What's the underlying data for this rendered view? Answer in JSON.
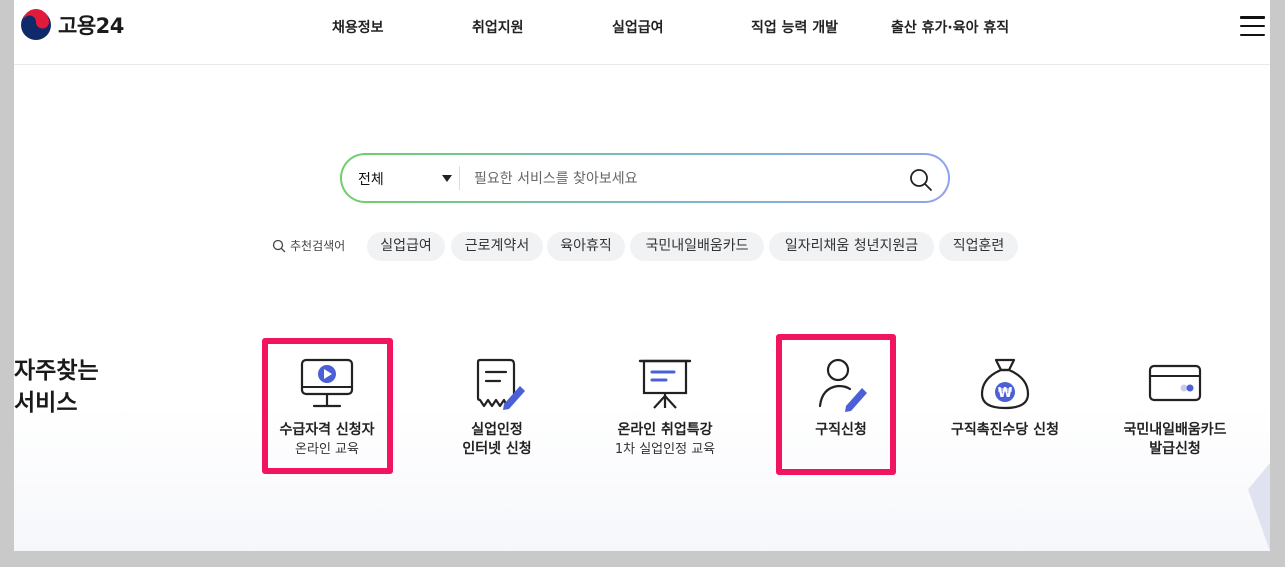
{
  "header": {
    "logo_text": "고용24",
    "nav": [
      "채용정보",
      "취업지원",
      "실업급여",
      "직업 능력 개발",
      "출산 휴가·육아 휴직"
    ]
  },
  "search": {
    "category": "전체",
    "placeholder": "필요한 서비스를 찾아보세요"
  },
  "keywords": {
    "label": "추천검색어",
    "items": [
      "실업급여",
      "근로계약서",
      "육아휴직",
      "국민내일배움카드",
      "일자리채움 청년지원금",
      "직업훈련"
    ]
  },
  "favorites": {
    "title_line1": "자주찾는",
    "title_line2": "서비스",
    "items": [
      {
        "line1": "수급자격 신청자",
        "line2": "온라인 교육",
        "icon": "monitor-play-icon",
        "highlighted": true
      },
      {
        "line1": "실업인정",
        "line2": "인터넷 신청",
        "icon": "document-pen-icon",
        "highlighted": false
      },
      {
        "line1": "온라인 취업특강",
        "line2": "1차 실업인정 교육",
        "icon": "presentation-board-icon",
        "highlighted": false
      },
      {
        "line1": "구직신청",
        "line2": "",
        "icon": "person-pen-icon",
        "highlighted": true
      },
      {
        "line1": "구직촉진수당 신청",
        "line2": "",
        "icon": "money-bag-won-icon",
        "highlighted": false
      },
      {
        "line1": "국민내일배움카드",
        "line2": "발급신청",
        "icon": "credit-card-icon",
        "highlighted": false
      }
    ]
  },
  "colors": {
    "highlight": "#f0155e",
    "accent_icon": "#4b5fd6",
    "search_gradient_start": "#6fcf6b",
    "search_gradient_end": "#8fa3ee"
  }
}
